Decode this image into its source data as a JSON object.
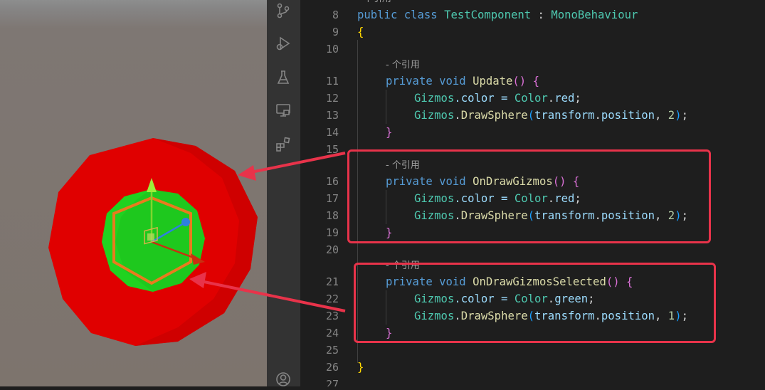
{
  "activity_bar": {
    "icons": [
      "source-control-icon",
      "run-debug-icon",
      "testing-icon",
      "remote-explorer-icon",
      "extensions-icon",
      "account-icon"
    ]
  },
  "editor": {
    "partial_lens_top": "- 个引用",
    "lines": {
      "l8": {
        "num": "8",
        "t1": "public",
        "t2": "class",
        "t3": "TestComponent",
        "t4": " : ",
        "t5": "MonoBehaviour"
      },
      "l9": {
        "num": "9",
        "t1": "{"
      },
      "l10": {
        "num": "10"
      },
      "l11_lens": "- 个引用",
      "l11": {
        "num": "11",
        "t1": "private",
        "t2": "void",
        "t3": "Update",
        "t4": "()",
        "t5": "{"
      },
      "l12": {
        "num": "12",
        "t1": "Gizmos",
        "t2": ".color = ",
        "t3": "Color",
        "t4": ".",
        "t5": "red",
        "t6": ";"
      },
      "l13": {
        "num": "13",
        "t1": "Gizmos",
        "t2": ".",
        "t3": "DrawSphere",
        "t4": "(",
        "t5": "transform",
        "t6": ".",
        "t7": "position",
        "t8": ", ",
        "t9": "2",
        "t10": ")",
        "t11": ";"
      },
      "l14": {
        "num": "14",
        "t1": "}"
      },
      "l15": {
        "num": "15"
      },
      "l16_lens": "- 个引用",
      "l16": {
        "num": "16",
        "t1": "private",
        "t2": "void",
        "t3": "OnDrawGizmos",
        "t4": "()",
        "t5": "{"
      },
      "l17": {
        "num": "17",
        "t1": "Gizmos",
        "t2": ".color = ",
        "t3": "Color",
        "t4": ".",
        "t5": "red",
        "t6": ";"
      },
      "l18": {
        "num": "18",
        "t1": "Gizmos",
        "t2": ".",
        "t3": "DrawSphere",
        "t4": "(",
        "t5": "transform",
        "t6": ".",
        "t7": "position",
        "t8": ", ",
        "t9": "2",
        "t10": ")",
        "t11": ";"
      },
      "l19": {
        "num": "19",
        "t1": "}"
      },
      "l20": {
        "num": "20"
      },
      "l21_lens": "- 个引用",
      "l21": {
        "num": "21",
        "t1": "private",
        "t2": "void",
        "t3": "OnDrawGizmosSelected",
        "t4": "()",
        "t5": "{"
      },
      "l22": {
        "num": "22",
        "t1": "Gizmos",
        "t2": ".color = ",
        "t3": "Color",
        "t4": ".",
        "t5": "green",
        "t6": ";"
      },
      "l23": {
        "num": "23",
        "t1": "Gizmos",
        "t2": ".",
        "t3": "DrawSphere",
        "t4": "(",
        "t5": "transform",
        "t6": ".",
        "t7": "position",
        "t8": ", ",
        "t9": "1",
        "t10": ")",
        "t11": ";"
      },
      "l24": {
        "num": "24",
        "t1": "}"
      },
      "l25": {
        "num": "25"
      },
      "l26": {
        "num": "26",
        "t1": "}"
      },
      "l27": {
        "num": "27"
      }
    }
  },
  "colors": {
    "annotation_red": "#e8334a",
    "sphere_red": "#e00000",
    "sphere_green": "#1ec81e",
    "selection_orange": "#e87b1e"
  }
}
